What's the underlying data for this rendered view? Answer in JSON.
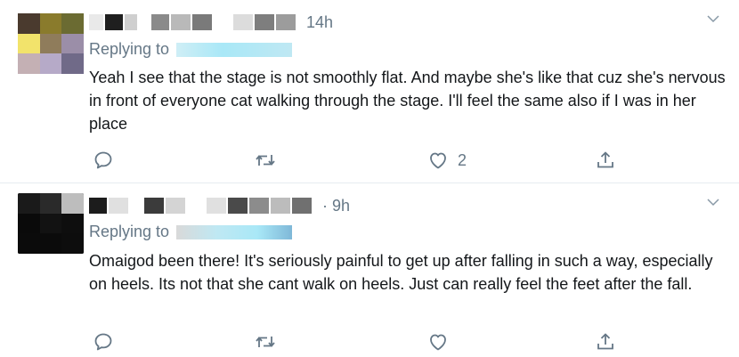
{
  "tweets": [
    {
      "time": "14h",
      "reply_label": "Replying to",
      "text": "Yeah I see that the stage is not smoothly flat. And maybe she's like that cuz she's nervous in front of everyone cat walking through the stage. I'll feel the same also if I was in her place",
      "like_count": "2",
      "avatar_colors": [
        "#4a3a2e",
        "#8a7b2c",
        "#6b6b32",
        "#f2e36b",
        "#8f7c5b",
        "#9b8ea8",
        "#c4b0b4",
        "#b6aac8",
        "#706a88"
      ]
    },
    {
      "time": "· 9h",
      "reply_label": "Replying to",
      "text": "Omaigod been there! It's seriously painful to get up after falling in such a way, especially on heels. Its not that she cant walk on heels. Just can really feel the feet after the fall.",
      "like_count": "",
      "avatar_colors": [
        "#1a1a1a",
        "#2a2a2a",
        "#bdbdbd",
        "#0a0a0a",
        "#121212",
        "#0e0e0e",
        "#0b0b0b",
        "#0b0b0b",
        "#0d0d0d"
      ]
    }
  ],
  "colors": {
    "icon": "#657786",
    "divider": "#e6ecf0",
    "handle_blur": "#a9e8f7"
  },
  "icons": [
    "chevron-down-icon",
    "reply-icon",
    "retweet-icon",
    "like-icon",
    "share-icon"
  ]
}
